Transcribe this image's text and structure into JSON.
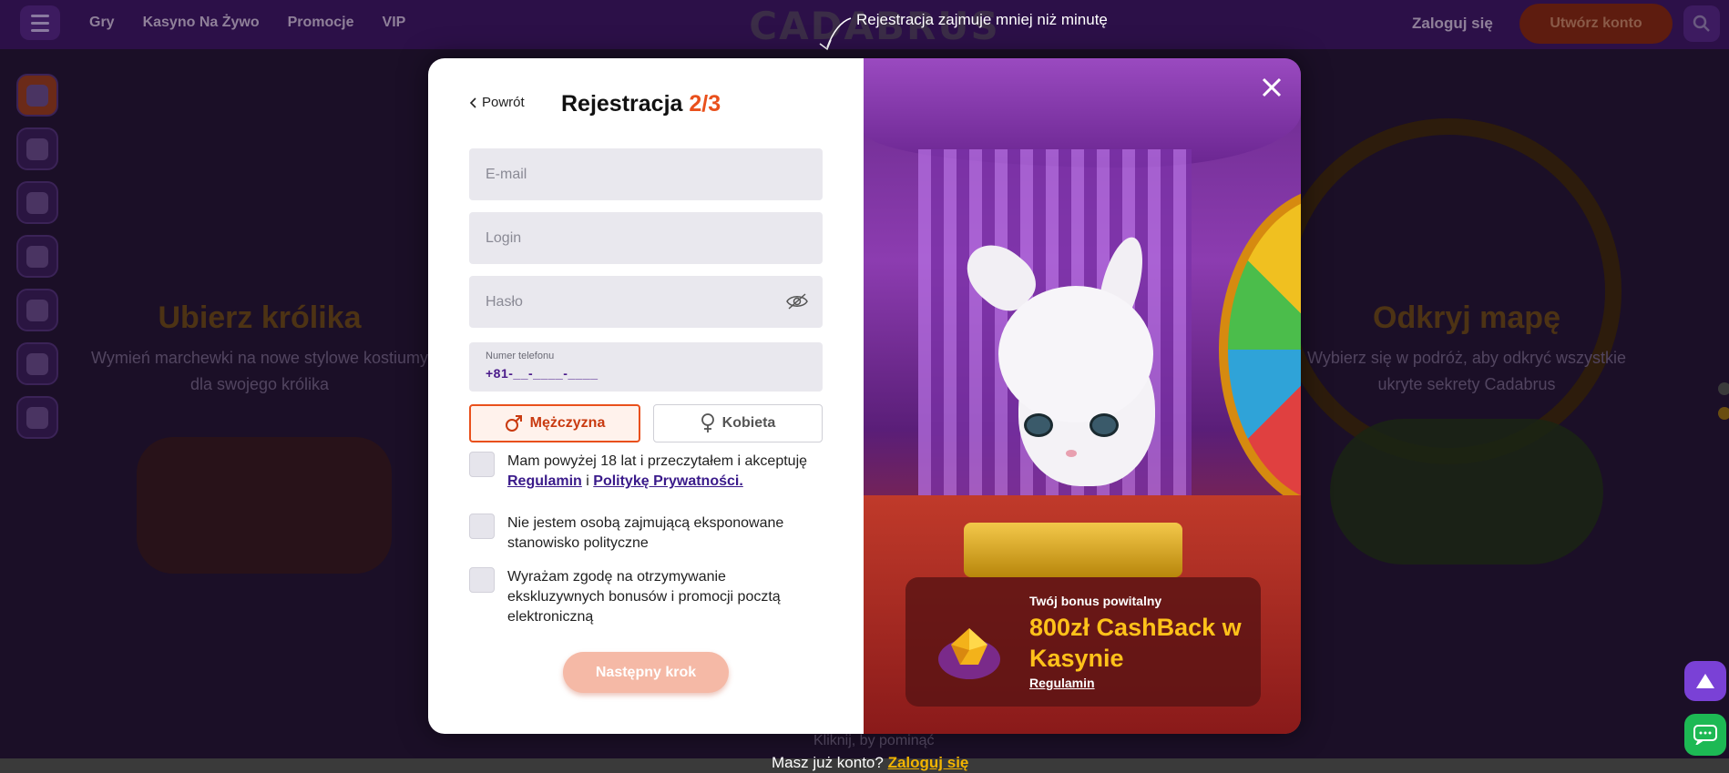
{
  "nav": {
    "items": [
      {
        "label": "Gry"
      },
      {
        "label": "Kasyno Na Żywo"
      },
      {
        "label": "Promocje"
      },
      {
        "label": "VIP"
      }
    ],
    "login_label": "Zaloguj się",
    "create_account_label": "Utwórz konto"
  },
  "logo": {
    "text": "CADABRUS"
  },
  "tooltip": {
    "text": "Rejestracja zajmuje mniej niż minutę"
  },
  "promos": {
    "left": {
      "title": "Ubierz królika",
      "subtitle": "Wymień marchewki na nowe stylowe kostiumy dla swojego królika"
    },
    "right": {
      "title": "Odkryj mapę",
      "subtitle": "Wybierz się w podróż, aby odkryć wszystkie ukryte sekrety Cadabrus"
    }
  },
  "modal": {
    "back_label": "Powrót",
    "title": "Rejestracja",
    "step": "2/3",
    "fields": {
      "email_placeholder": "E-mail",
      "login_placeholder": "Login",
      "password_placeholder": "Hasło",
      "phone_label": "Numer telefonu",
      "phone_value": "+81-__-____-____"
    },
    "gender": {
      "male_label": "Mężczyzna",
      "female_label": "Kobieta",
      "selected": "male"
    },
    "checks": {
      "age_text": "Mam powyżej 18 lat i przeczytałem i akceptuję",
      "age_link_terms": "Regulamin",
      "age_link_and": "i",
      "age_link_privacy": "Politykę Prywatności.",
      "pep_text": "Nie jestem osobą zajmującą eksponowane stanowisko polityczne",
      "marketing_text": "Wyrażam zgodę na otrzymywanie ekskluzywnych bonusów i promocji pocztą elektroniczną"
    },
    "next_label": "Następny krok",
    "bonus": {
      "label": "Twój bonus powitalny",
      "title": "800zł CashBack w Kasynie",
      "terms_link": "Regulamin"
    }
  },
  "skip_text": "Kliknij, by pominąć",
  "footer": {
    "have_account": "Masz już konto?",
    "login_link": "Zaloguj się"
  },
  "colors": {
    "accent": "#e9501c",
    "link": "#3a1a8a",
    "bonus_gold": "#ffc21a",
    "footer_link": "#f2b400"
  }
}
